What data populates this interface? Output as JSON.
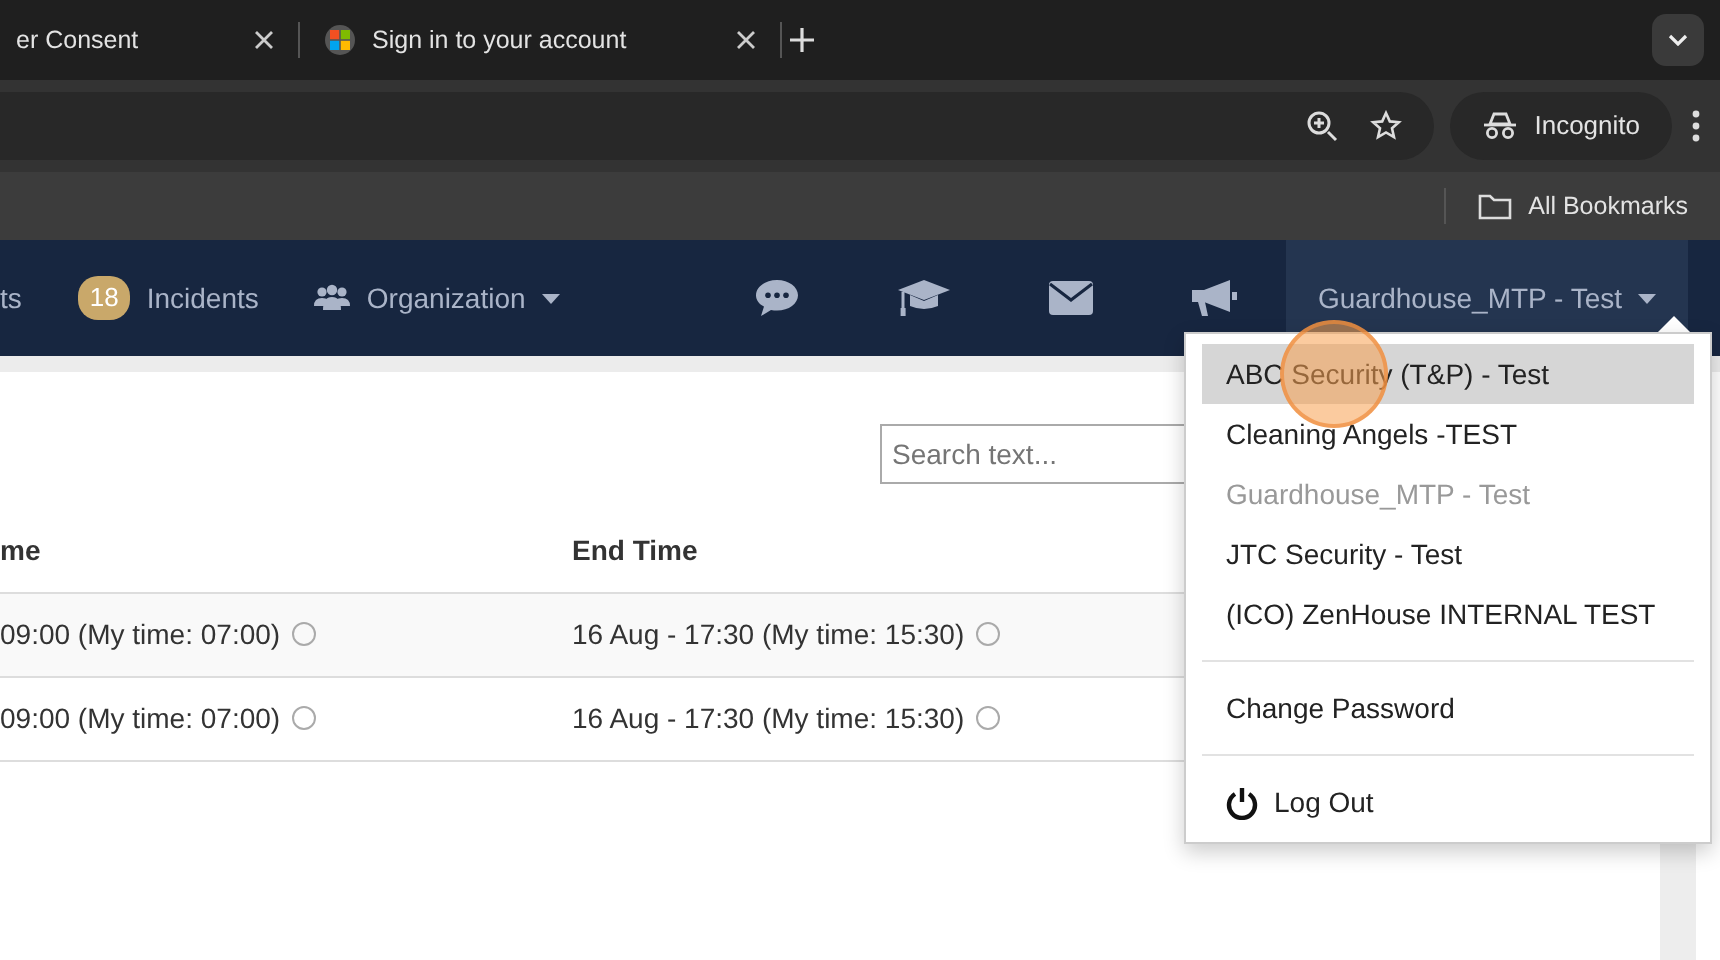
{
  "browser": {
    "tabs": [
      {
        "title": "er Consent",
        "kind": "plain"
      },
      {
        "title": "Sign in to your account",
        "kind": "logo"
      }
    ],
    "profile": "Incognito",
    "bookmarks": [
      "All Bookmarks"
    ]
  },
  "navbar": {
    "items": [
      {
        "label": "ts",
        "kind": "text"
      },
      {
        "label": "Incidents",
        "kind": "badge",
        "badge": "18"
      },
      {
        "label": "Organization",
        "kind": "dropdown"
      }
    ],
    "account": "Guardhouse_MTP - Test"
  },
  "search": {
    "placeholder": "Search text..."
  },
  "table": {
    "columns": [
      "me",
      "End Time"
    ],
    "rows": [
      [
        "09:00 (My time: 07:00)",
        "16 Aug - 17:30 (My time: 15:30)"
      ],
      [
        "09:00 (My time: 07:00)",
        "16 Aug - 17:30 (My time: 15:30)"
      ]
    ]
  },
  "menu": {
    "groups": [
      [
        {
          "label": "ABC Security (T&P) - Test",
          "hovered": true,
          "disabled": false
        },
        {
          "label": "Cleaning Angels -TEST",
          "hovered": false,
          "disabled": false
        },
        {
          "label": "Guardhouse_MTP - Test",
          "hovered": false,
          "disabled": true
        },
        {
          "label": "JTC Security - Test",
          "hovered": false,
          "disabled": false
        },
        {
          "label": "(ICO) ZenHouse INTERNAL TEST",
          "hovered": false,
          "disabled": false
        }
      ],
      [
        {
          "label": "Change Password",
          "hovered": false,
          "disabled": false
        }
      ],
      [
        {
          "label": "Log Out",
          "hovered": false,
          "disabled": false,
          "kind": "power"
        }
      ]
    ]
  }
}
